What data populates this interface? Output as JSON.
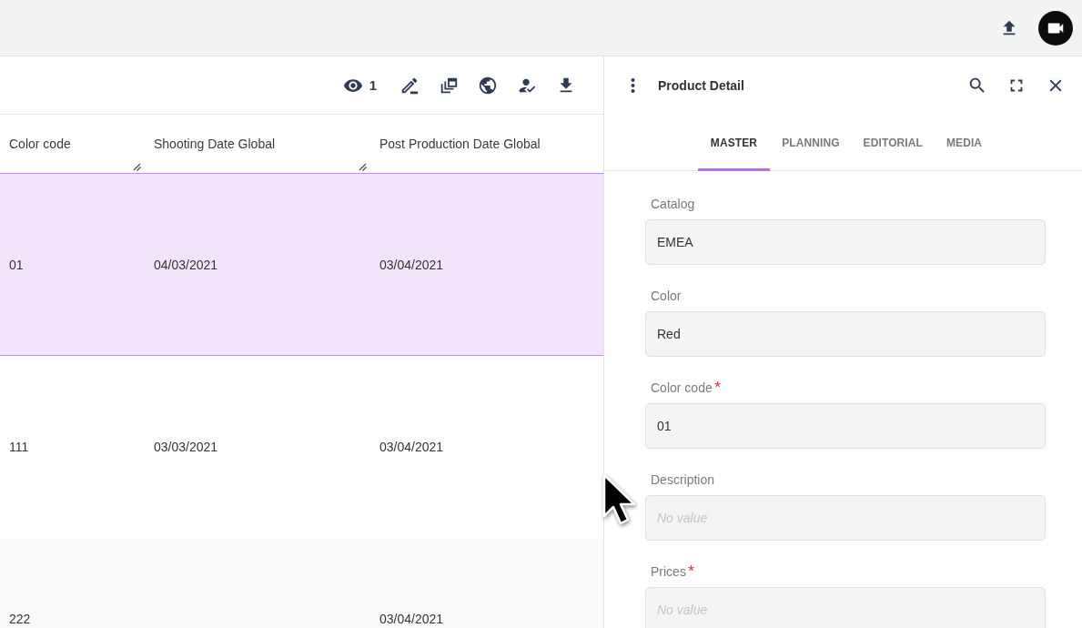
{
  "toolbar": {
    "visible_count": "1"
  },
  "table": {
    "columns": [
      "Color code",
      "Shooting Date Global",
      "Post Production Date Global"
    ],
    "rows": [
      {
        "cells": [
          "01",
          "04/03/2021",
          "03/04/2021"
        ],
        "selected": true
      },
      {
        "cells": [
          "111",
          "03/03/2021",
          "03/04/2021"
        ],
        "selected": false
      },
      {
        "cells": [
          "222",
          null,
          "03/04/2021"
        ],
        "selected": false
      }
    ]
  },
  "detail": {
    "title": "Product Detail",
    "tabs": [
      {
        "label": "MASTER",
        "selected": true
      },
      {
        "label": "PLANNING",
        "selected": false
      },
      {
        "label": "EDITORIAL",
        "selected": false
      },
      {
        "label": "MEDIA",
        "selected": false
      }
    ],
    "fields": [
      {
        "label": "Catalog",
        "value": "EMEA",
        "required": false
      },
      {
        "label": "Color",
        "value": "Red",
        "required": false
      },
      {
        "label": "Color code",
        "value": "01",
        "required": true
      },
      {
        "label": "Description",
        "placeholder": "No value",
        "required": false
      },
      {
        "label": "Prices",
        "placeholder": "No value",
        "required": true
      }
    ]
  }
}
